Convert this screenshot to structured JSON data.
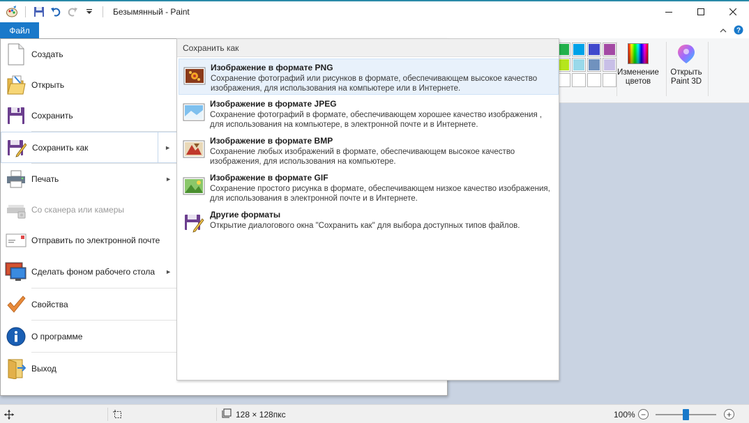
{
  "window": {
    "title": "Безымянный - Paint"
  },
  "ribbon": {
    "file_tab": "Файл",
    "edit_colors_label": "Изменение цветов",
    "edit_colors_line1": "Изменение",
    "edit_colors_line2": "цветов",
    "paint3d_label": "Открыть Paint 3D",
    "paint3d_line1": "Открыть",
    "paint3d_line2": "Paint 3D",
    "palette": [
      "#22b14c",
      "#00a2e8",
      "#3f48cc",
      "#a349a4",
      "#b5e61d",
      "#99d9ea",
      "#7092be",
      "#c8bfe7",
      "#ffffff",
      "#ffffff",
      "#ffffff",
      "#ffffff"
    ]
  },
  "file_menu": {
    "items": [
      {
        "label": "Создать",
        "icon": "new-file-icon",
        "has_submenu": false,
        "enabled": true
      },
      {
        "label": "Открыть",
        "icon": "open-folder-icon",
        "has_submenu": false,
        "enabled": true
      },
      {
        "label": "Сохранить",
        "icon": "save-disk-icon",
        "has_submenu": false,
        "enabled": true
      },
      {
        "label": "Сохранить как",
        "icon": "save-as-icon",
        "has_submenu": true,
        "enabled": true
      },
      {
        "label": "Печать",
        "icon": "printer-icon",
        "has_submenu": true,
        "enabled": true
      },
      {
        "label": "Со сканера или камеры",
        "icon": "scanner-icon",
        "has_submenu": false,
        "enabled": false
      },
      {
        "label": "Отправить по электронной почте",
        "icon": "email-icon",
        "has_submenu": false,
        "enabled": true
      },
      {
        "label": "Сделать фоном рабочего стола",
        "icon": "desktop-background-icon",
        "has_submenu": true,
        "enabled": true
      },
      {
        "label": "Свойства",
        "icon": "checkmark-icon",
        "has_submenu": false,
        "enabled": true
      },
      {
        "label": "О программе",
        "icon": "info-icon",
        "has_submenu": false,
        "enabled": true
      },
      {
        "label": "Выход",
        "icon": "exit-icon",
        "has_submenu": false,
        "enabled": true
      }
    ]
  },
  "save_as": {
    "header": "Сохранить как",
    "items": [
      {
        "title": "Изображение в формате PNG",
        "desc": "Сохранение фотографий или рисунков в формате, обеспечивающем высокое качество изображения, для использования на компьютере или в Интернете.",
        "icon": "png-image-icon"
      },
      {
        "title": "Изображение в формате JPEG",
        "desc": "Сохранение фотографий в формате, обеспечивающем хорошее качество изображения , для использования на компьютере, в электронной почте и в Интернете.",
        "icon": "jpeg-image-icon"
      },
      {
        "title": "Изображение в формате BMP",
        "desc": "Сохранение любых изображений в формате, обеспечивающем высокое качество изображения, для использования на компьютере.",
        "icon": "bmp-image-icon"
      },
      {
        "title": "Изображение в формате GIF",
        "desc": "Сохранение простого рисунка в формате, обеспечивающем низкое качество изображения, для использования в электронной почте и в Интернете.",
        "icon": "gif-image-icon"
      },
      {
        "title": "Другие форматы",
        "desc": "Открытие диалогового окна \"Сохранить как\" для выбора доступных типов файлов.",
        "icon": "other-formats-icon"
      }
    ]
  },
  "statusbar": {
    "image_size": "128 × 128пкс",
    "zoom": "100%",
    "zoom_level": 0.5
  },
  "colors": {
    "accent": "#1979ca",
    "canvas_bg": "#c9d3e2",
    "highlight": "#e8f1fb"
  }
}
